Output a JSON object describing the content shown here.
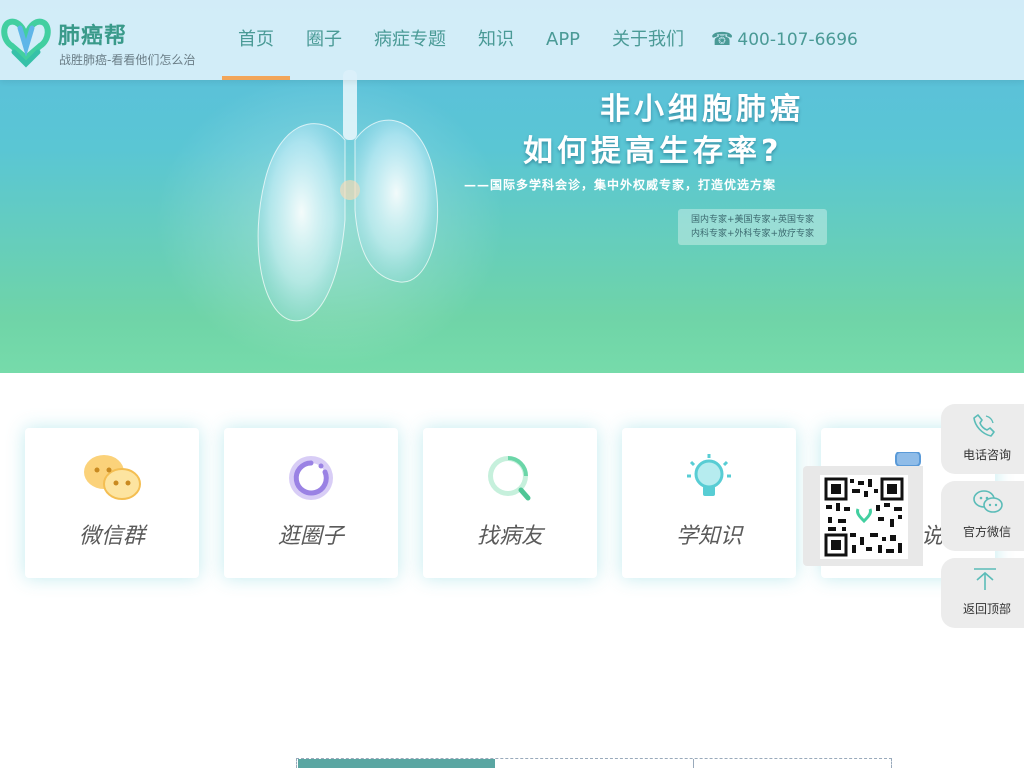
{
  "header": {
    "logo_title": "肺癌帮",
    "logo_subtitle": "战胜肺癌-看看他们怎么治",
    "nav": [
      {
        "label": "首页",
        "active": true
      },
      {
        "label": "圈子",
        "active": false
      },
      {
        "label": "病症专题",
        "active": false
      },
      {
        "label": "知识",
        "active": false
      },
      {
        "label": "APP",
        "active": false
      },
      {
        "label": "关于我们",
        "active": false
      }
    ],
    "phone_icon": "☎",
    "phone": "400-107-6696"
  },
  "banner": {
    "title_line1": "非小细胞肺癌",
    "title_line2": "如何提高生存率?",
    "subtitle": "——国际多学科会诊，集中外权威专家，打造优选方案",
    "tag_line1": "国内专家+美国专家+英国专家",
    "tag_line2": "内科专家+外科专家+放疗专家"
  },
  "cards": [
    {
      "label": "微信群",
      "icon": "wechat-group-icon"
    },
    {
      "label": "逛圈子",
      "icon": "circle-icon"
    },
    {
      "label": "找病友",
      "icon": "search-icon"
    },
    {
      "label": "学知识",
      "icon": "lightbulb-icon"
    },
    {
      "label": "说",
      "icon": "chat-icon"
    }
  ],
  "sidebar": {
    "phone_label": "电话咨询",
    "wechat_label": "官方微信",
    "top_label": "返回顶部"
  },
  "colors": {
    "accent": "#4a9a96",
    "active_underline": "#f2a65a",
    "banner_top": "#5cbcdf",
    "banner_bottom": "#76dbaa"
  }
}
